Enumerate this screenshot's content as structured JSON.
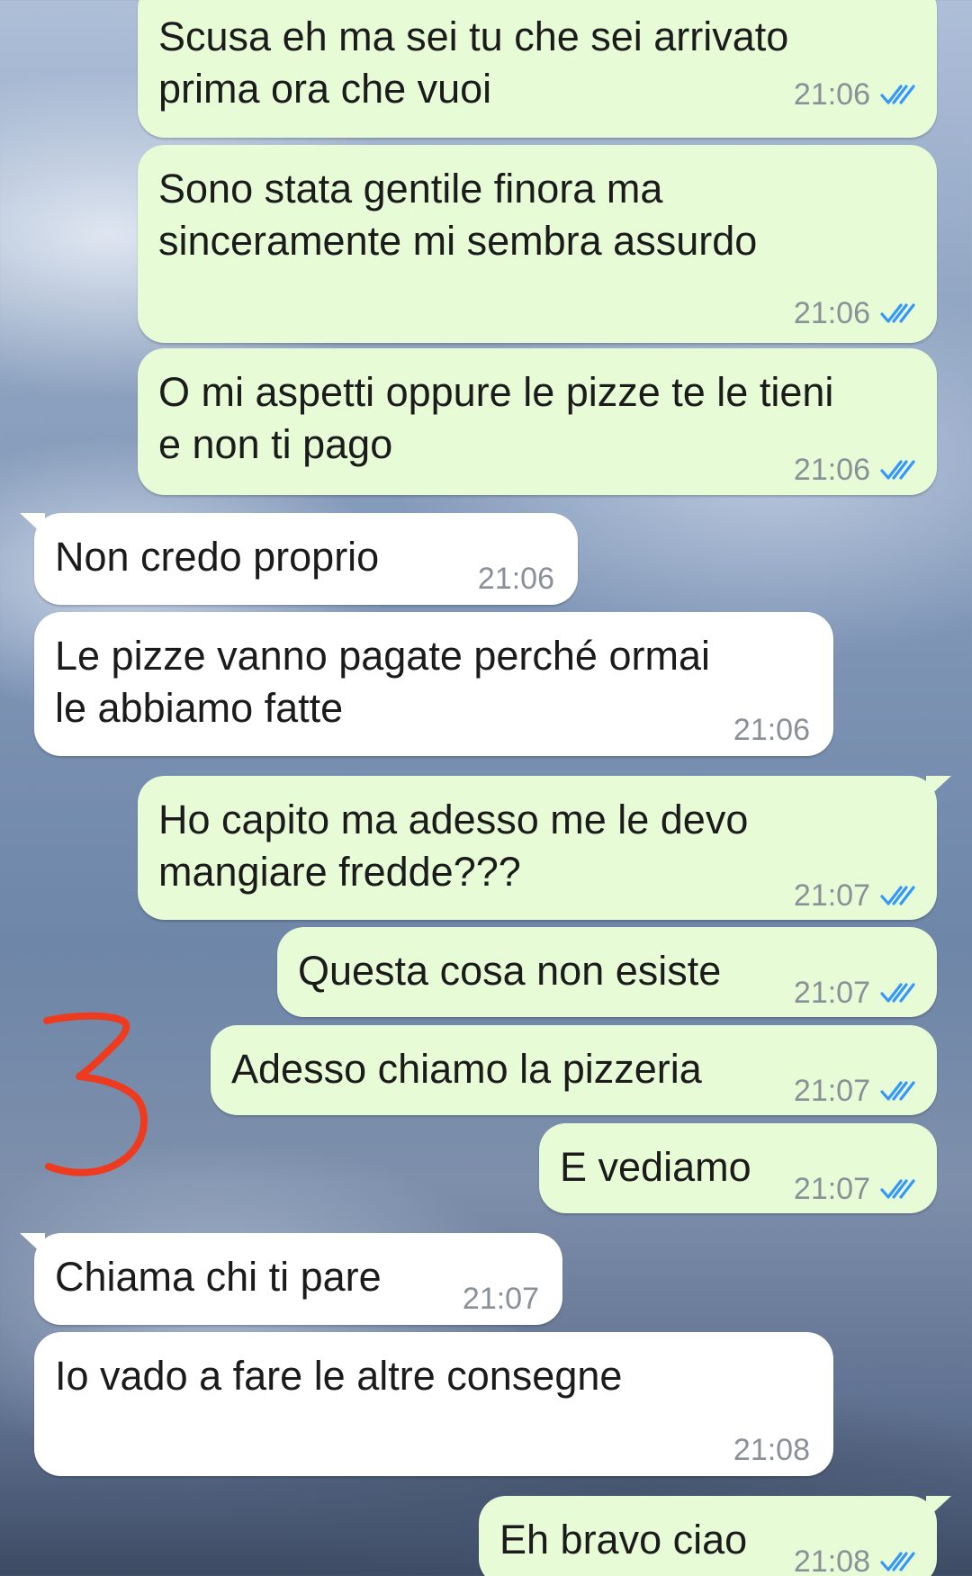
{
  "messages": [
    {
      "dir": "out",
      "text": "Scusa eh ma sei tu che sei arrivato\nprima ora che vuoi",
      "time": "21:06",
      "status": "read"
    },
    {
      "dir": "out",
      "text": "Sono stata gentile finora ma\nsinceramente mi sembra assurdo",
      "time": "21:06",
      "status": "read"
    },
    {
      "dir": "out",
      "text": "O mi aspetti oppure le pizze te le tieni\ne non ti pago",
      "time": "21:06",
      "status": "read"
    },
    {
      "dir": "in",
      "text": "Non credo proprio",
      "time": "21:06"
    },
    {
      "dir": "in",
      "text": "Le pizze vanno pagate perché ormai\nle abbiamo fatte",
      "time": "21:06"
    },
    {
      "dir": "out",
      "text": "Ho capito ma adesso me le devo\nmangiare fredde???",
      "time": "21:07",
      "status": "read"
    },
    {
      "dir": "out",
      "text": "Questa cosa non esiste",
      "time": "21:07",
      "status": "read"
    },
    {
      "dir": "out",
      "text": "Adesso chiamo la pizzeria",
      "time": "21:07",
      "status": "read"
    },
    {
      "dir": "out",
      "text": "E vediamo",
      "time": "21:07",
      "status": "read"
    },
    {
      "dir": "in",
      "text": "Chiama chi ti pare",
      "time": "21:07"
    },
    {
      "dir": "in",
      "text": "Io vado a fare le altre consegne",
      "time": "21:08"
    },
    {
      "dir": "out",
      "text": "Eh bravo ciao",
      "time": "21:08",
      "status": "read"
    }
  ],
  "annotation": {
    "text": "3",
    "color": "#ee3b1f"
  },
  "colors": {
    "outgoing_bubble": "#e7fcd6",
    "incoming_bubble": "#ffffff",
    "read_ticks": "#3497f9",
    "timestamp": "#8a9097"
  },
  "icons": {
    "read_receipt": "double-check-icon"
  }
}
